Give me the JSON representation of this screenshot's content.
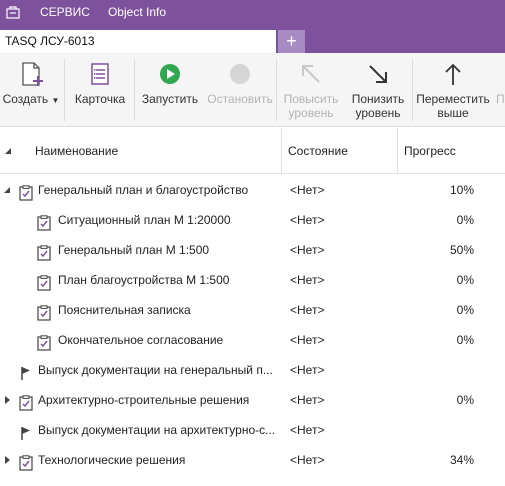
{
  "menu": {
    "service": "СЕРВИС",
    "object_info": "Object Info"
  },
  "tab": {
    "title": "TASQ ЛСУ-6013",
    "add": "+"
  },
  "toolbar": {
    "create": "Создать",
    "card": "Карточка",
    "start": "Запустить",
    "stop": "Остановить",
    "raise_1": "Повысить",
    "raise_2": "уровень",
    "lower_1": "Понизить",
    "lower_2": "уровень",
    "move_1": "Переместить",
    "move_2": "выше",
    "next_partial": "П"
  },
  "columns": {
    "name": "Наименование",
    "state": "Состояние",
    "progress": "Прогресс"
  },
  "rows": [
    {
      "name": "Генеральный план и благоустройство",
      "state": "<Нет>",
      "progress": "10%"
    },
    {
      "name": "Ситуационный план М 1:20000",
      "state": "<Нет>",
      "progress": "0%"
    },
    {
      "name": "Генеральный план М 1:500",
      "state": "<Нет>",
      "progress": "50%"
    },
    {
      "name": "План благоустройства М 1:500",
      "state": "<Нет>",
      "progress": "0%"
    },
    {
      "name": "Пояснительная записка",
      "state": "<Нет>",
      "progress": "0%"
    },
    {
      "name": "Окончательное согласование",
      "state": "<Нет>",
      "progress": "0%"
    },
    {
      "name": "Выпуск документации на генеральный п...",
      "state": "<Нет>",
      "progress": ""
    },
    {
      "name": "Архитектурно-строительные решения",
      "state": "<Нет>",
      "progress": "0%"
    },
    {
      "name": "Выпуск документации на архитектурно-с...",
      "state": "<Нет>",
      "progress": ""
    },
    {
      "name": "Технологические решения",
      "state": "<Нет>",
      "progress": "34%"
    }
  ],
  "colors": {
    "accent": "#7d519c",
    "start_green": "#2fa84f"
  }
}
